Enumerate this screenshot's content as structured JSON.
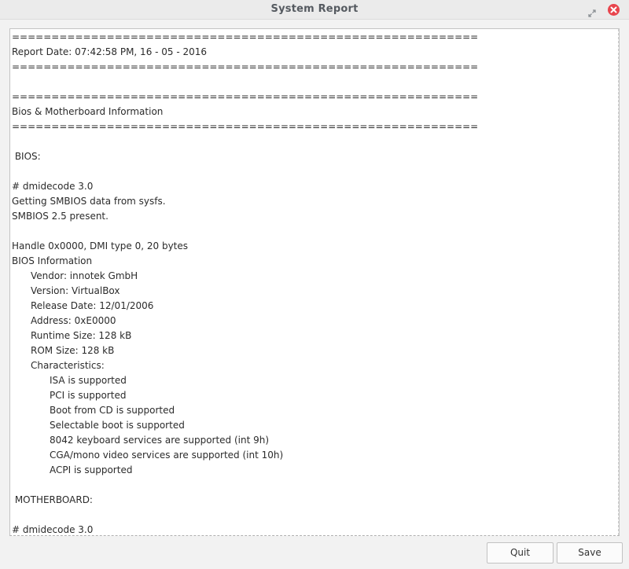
{
  "window": {
    "title": "System Report"
  },
  "titlebar_icons": {
    "restore": "restore-icon",
    "close": "close-icon",
    "close_color": "#e8454d"
  },
  "report": {
    "text": "===========================================================\nReport Date: 07:42:58 PM, 16 - 05 - 2016\n===========================================================\n\n===========================================================\nBios & Motherboard Information\n===========================================================\n\n BIOS:\n\n# dmidecode 3.0\nGetting SMBIOS data from sysfs.\nSMBIOS 2.5 present.\n\nHandle 0x0000, DMI type 0, 20 bytes\nBIOS Information\n\tVendor: innotek GmbH\n\tVersion: VirtualBox\n\tRelease Date: 12/01/2006\n\tAddress: 0xE0000\n\tRuntime Size: 128 kB\n\tROM Size: 128 kB\n\tCharacteristics:\n\t\tISA is supported\n\t\tPCI is supported\n\t\tBoot from CD is supported\n\t\tSelectable boot is supported\n\t\t8042 keyboard services are supported (int 9h)\n\t\tCGA/mono video services are supported (int 10h)\n\t\tACPI is supported\n\n MOTHERBOARD:\n\n# dmidecode 3.0"
  },
  "buttons": {
    "quit_label": "Quit",
    "save_label": "Save"
  }
}
